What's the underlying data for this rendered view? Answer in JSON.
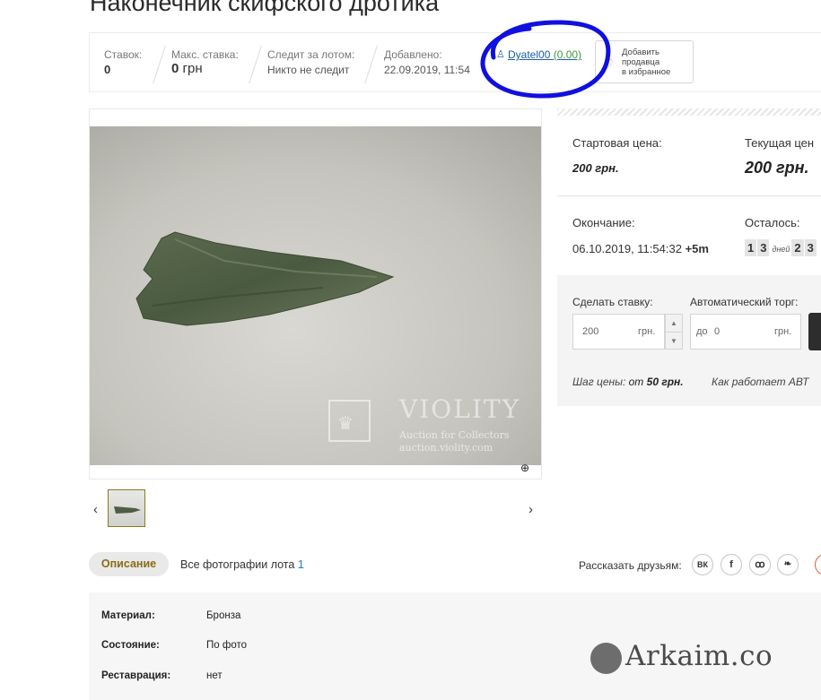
{
  "lot": {
    "title": "Наконечник скифского дротика"
  },
  "stats": {
    "bids_label": "Ставок:",
    "bids_value": "0",
    "max_bid_label": "Макс. ставка:",
    "max_bid_value": "0",
    "max_bid_currency": "грн",
    "watching_label": "Следит за лотом:",
    "watching_value": "Никто не следит",
    "added_label": "Добавлено:",
    "added_value": "22.09.2019, 11:54"
  },
  "seller": {
    "name": "Dyatel00",
    "rating": "(0.00)",
    "favorite_button": [
      "Добавить",
      "продавца",
      "в избранное"
    ]
  },
  "photo": {
    "watermark_brand": "VIOLITY",
    "watermark_sub": "Auction for Collectors",
    "watermark_url": "auction.violity.com"
  },
  "pricing": {
    "start_label": "Стартовая цена:",
    "start_value": "200 грн.",
    "current_label": "Текущая цен",
    "current_value": "200 грн.",
    "end_label": "Окончание:",
    "end_value": "06.10.2019, 11:54:32",
    "end_extra": "+5m",
    "left_label": "Осталось:",
    "timer_days_digits": [
      "1",
      "3"
    ],
    "timer_days_unit": "дней",
    "timer_hours_digits": [
      "2",
      "3"
    ]
  },
  "bid": {
    "bid_label": "Сделать ставку:",
    "bid_value": "200",
    "bid_currency": "грн.",
    "auto_label": "Автоматический торг:",
    "auto_prefix": "до",
    "auto_value": "0",
    "auto_currency": "грн.",
    "step_text": "Шаг цены:",
    "step_from": "от",
    "step_value": "50 грн.",
    "how_text": "Как работает АВТ"
  },
  "tabs": {
    "description": "Описание",
    "all_photos": "Все фотографии лота",
    "all_photos_count": "1",
    "share_label": "Рассказать друзьям:",
    "social": [
      "вк",
      "f",
      "ok",
      "tw"
    ]
  },
  "description": {
    "rows": [
      {
        "key": "Материал:",
        "value": "Бронза"
      },
      {
        "key": "Состояние:",
        "value": "По фото"
      },
      {
        "key": "Реставрация:",
        "value": "нет"
      }
    ]
  },
  "overlay": {
    "watermark": "Arkaim.co"
  },
  "colors": {
    "annotation_circle": "#1010e0",
    "seller_link": "#1a5fa8",
    "active_tab_text": "#8a6b16"
  }
}
